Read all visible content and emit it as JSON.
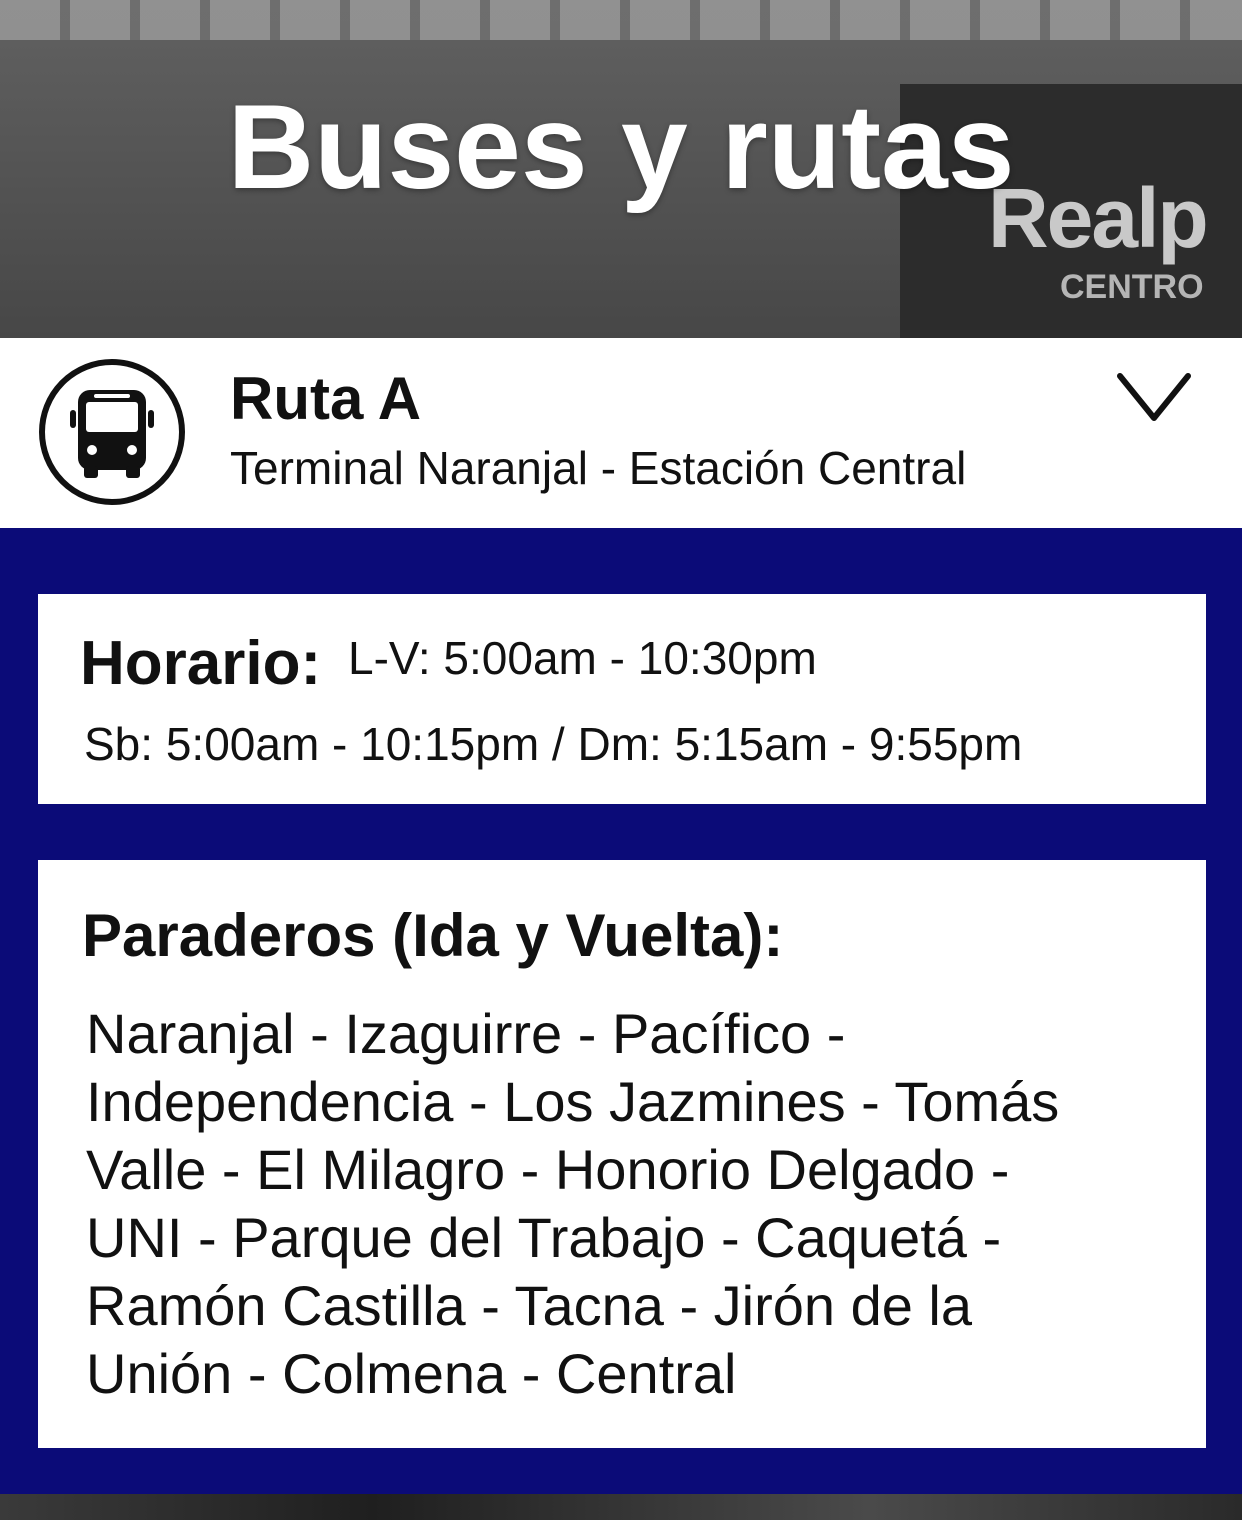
{
  "header": {
    "title": "Buses y rutas",
    "background_sign_text": "Realp",
    "background_sign_subtext": "CENTRO"
  },
  "route": {
    "icon": "bus-icon",
    "name": "Ruta A",
    "description": "Terminal Naranjal - Estación Central",
    "toggle_icon": "chevron-down-icon"
  },
  "schedule": {
    "label": "Horario:",
    "weekdays": "L-V: 5:00am - 10:30pm",
    "weekend": "Sb: 5:00am - 10:15pm / Dm: 5:15am - 9:55pm"
  },
  "stops": {
    "label": "Paraderos (Ida y Vuelta):",
    "lines": [
      "Naranjal - Izaguirre - Pacífico -",
      "Independencia - Los Jazmines - Tomás",
      "Valle - El Milagro - Honorio Delgado -",
      "UNI - Parque del Trabajo - Caquetá -",
      "Ramón Castilla - Tacna - Jirón de la",
      "Unión - Colmena - Central"
    ]
  },
  "colors": {
    "panel_blue": "#0b0b78",
    "card_white": "#ffffff",
    "text_dark": "#111111"
  }
}
